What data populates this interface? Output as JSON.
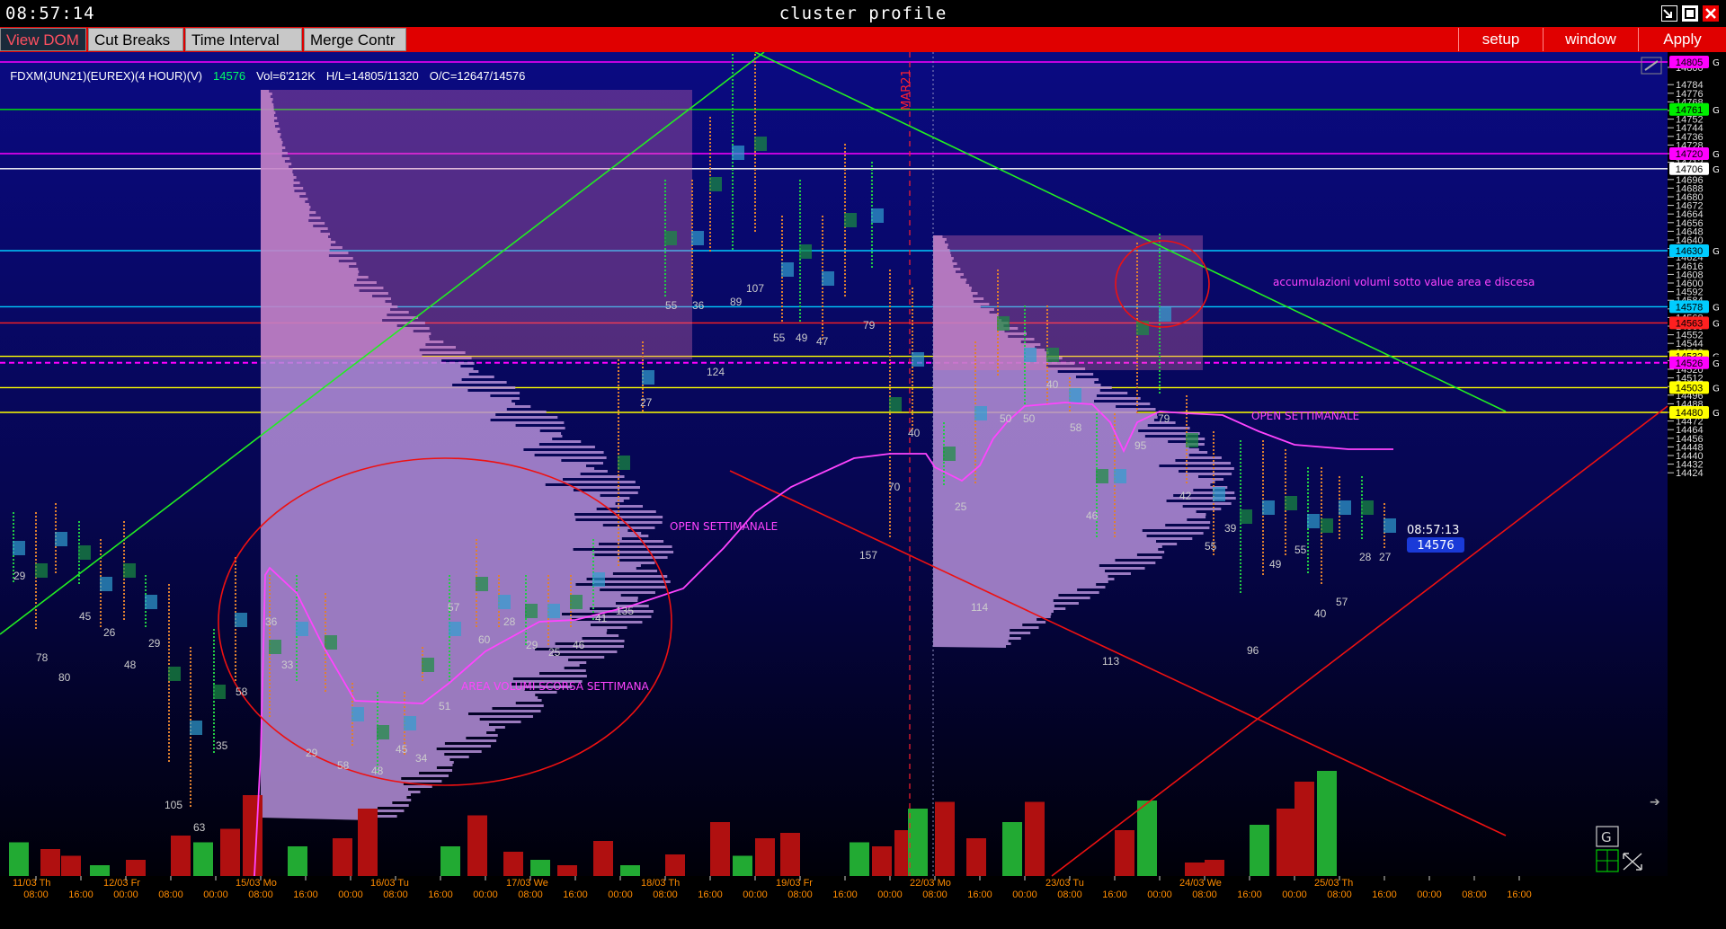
{
  "window": {
    "clock": "08:57:14",
    "title": "cluster profile"
  },
  "toolbar": {
    "left_buttons": [
      "View DOM",
      "Cut Breaks",
      "Time Interval",
      "Merge Contr"
    ],
    "right_buttons": [
      "setup",
      "window",
      "Apply"
    ]
  },
  "info": {
    "symbol": "FDXM(JUN21)(EUREX)(4 HOUR)(V)",
    "last": "14576",
    "volume": "Vol=6'212K",
    "high_low": "H/L=14805/11320",
    "open_close": "O/C=12647/14576"
  },
  "price_axis": {
    "ticks": [
      "14800",
      "14784",
      "14776",
      "14768",
      "14760",
      "14752",
      "14744",
      "14736",
      "14728",
      "14720",
      "14712",
      "14696",
      "14688",
      "14680",
      "14672",
      "14664",
      "14656",
      "14648",
      "14640",
      "14632",
      "14624",
      "14616",
      "14608",
      "14600",
      "14592",
      "14584",
      "14576",
      "14568",
      "14560",
      "14552",
      "14544",
      "14536",
      "14528",
      "14520",
      "14512",
      "14504",
      "14496",
      "14488",
      "14480",
      "14472",
      "14464",
      "14456",
      "14448",
      "14440",
      "14432",
      "14424"
    ],
    "labels": [
      {
        "value": "14805",
        "color": "#ff00ff"
      },
      {
        "value": "14761",
        "color": "#00ee00"
      },
      {
        "value": "14720",
        "color": "#ff00ff"
      },
      {
        "value": "14706",
        "color": "#ffffff"
      },
      {
        "value": "14630",
        "color": "#00ccff"
      },
      {
        "value": "14578",
        "color": "#00ccff"
      },
      {
        "value": "14563",
        "color": "#ff2020"
      },
      {
        "value": "14532",
        "color": "#ffff00"
      },
      {
        "value": "14526",
        "color": "#ff00ff"
      },
      {
        "value": "14503",
        "color": "#ffff00"
      },
      {
        "value": "14480",
        "color": "#ffff00"
      }
    ],
    "g_marker": "G"
  },
  "time_axis": {
    "dates": [
      "11/03 Th",
      "12/03 Fr",
      "15/03 Mo",
      "16/03 Tu",
      "17/03 We",
      "18/03 Th",
      "19/03 Fr",
      "22/03 Mo",
      "23/03 Tu",
      "24/03 We",
      "25/03 Th"
    ],
    "times": [
      "08:00",
      "16:00",
      "00:00",
      "08:00",
      "00:00",
      "08:00",
      "16:00",
      "00:00",
      "08:00",
      "16:00",
      "00:00",
      "08:00",
      "16:00",
      "00:00",
      "08:00",
      "16:00",
      "00:00",
      "08:00",
      "16:00",
      "00:00",
      "08:00",
      "16:00",
      "00:00",
      "08:00",
      "16:00",
      "00:00",
      "08:00",
      "16:00",
      "00:00",
      "08:00",
      "16:00",
      "00:00",
      "08:00",
      "16:00"
    ]
  },
  "annotations": {
    "area_volumi": "AREA VOLUMI SCORSA SETTIMANA",
    "open_settimanale_1": "OPEN SETTIMANALE",
    "open_settimanale_2": "OPEN  SETTIMANALE",
    "accumulazioni": "accumulazioni volumi sotto value area e discesa",
    "mar21": "MAR21"
  },
  "last_price_tag": {
    "time": "08:57:13",
    "price": "14576"
  },
  "bar_counts": [
    {
      "v": "29"
    },
    {
      "v": "45"
    },
    {
      "v": "26"
    },
    {
      "v": "78"
    },
    {
      "v": "80"
    },
    {
      "v": "48"
    },
    {
      "v": "29"
    },
    {
      "v": "105"
    },
    {
      "v": "63"
    },
    {
      "v": "35"
    },
    {
      "v": "58"
    },
    {
      "v": "33"
    },
    {
      "v": "36"
    },
    {
      "v": "29"
    },
    {
      "v": "58"
    },
    {
      "v": "48"
    },
    {
      "v": "45"
    },
    {
      "v": "34"
    },
    {
      "v": "51"
    },
    {
      "v": "57"
    },
    {
      "v": "60"
    },
    {
      "v": "28"
    },
    {
      "v": "29"
    },
    {
      "v": "25"
    },
    {
      "v": "46"
    },
    {
      "v": "41"
    },
    {
      "v": "135"
    },
    {
      "v": "27"
    },
    {
      "v": "55"
    },
    {
      "v": "36"
    },
    {
      "v": "89"
    },
    {
      "v": "107"
    },
    {
      "v": "124"
    },
    {
      "v": "55"
    },
    {
      "v": "49"
    },
    {
      "v": "47"
    },
    {
      "v": "79"
    },
    {
      "v": "157"
    },
    {
      "v": "70"
    },
    {
      "v": "40"
    },
    {
      "v": "25"
    },
    {
      "v": "114"
    },
    {
      "v": "50"
    },
    {
      "v": "50"
    },
    {
      "v": "40"
    },
    {
      "v": "58"
    },
    {
      "v": "46"
    },
    {
      "v": "113"
    },
    {
      "v": "95"
    },
    {
      "v": "79"
    },
    {
      "v": "42"
    },
    {
      "v": "55"
    },
    {
      "v": "39"
    },
    {
      "v": "96"
    },
    {
      "v": "49"
    },
    {
      "v": "55"
    },
    {
      "v": "40"
    },
    {
      "v": "57"
    },
    {
      "v": "28"
    },
    {
      "v": "27"
    }
  ],
  "colors": {
    "menubar": "#e00000",
    "background_top": "#0a0a7a",
    "background_bottom": "#000010",
    "profile_pink": "#d070c0",
    "profile_blue": "#9ab4f0",
    "trend_green": "#22ee22",
    "trend_red": "#ee1111",
    "vwap_magenta": "#ff44ff"
  }
}
